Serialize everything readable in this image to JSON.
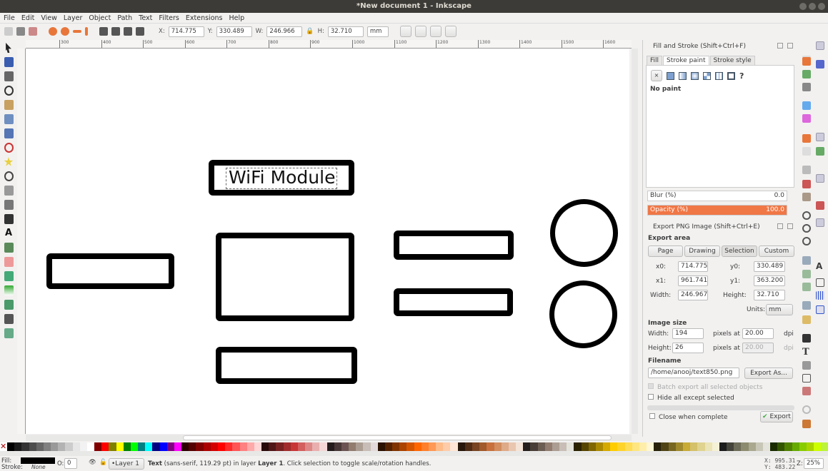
{
  "window": {
    "title": "*New document 1 - Inkscape"
  },
  "menu": [
    "File",
    "Edit",
    "View",
    "Layer",
    "Object",
    "Path",
    "Text",
    "Filters",
    "Extensions",
    "Help"
  ],
  "toolbar": {
    "x_label": "X:",
    "x": "714.775",
    "y_label": "Y:",
    "y": "330.489",
    "w_label": "W:",
    "w": "246.966",
    "h_label": "H:",
    "h": "32.710",
    "unit": "mm"
  },
  "ruler": [
    "300",
    "400",
    "500",
    "600",
    "700",
    "800",
    "900",
    "1000",
    "1100",
    "1200",
    "1300",
    "1400",
    "1500",
    "1600"
  ],
  "canvas": {
    "text": "WiFi Module"
  },
  "fill_stroke": {
    "title": "Fill and Stroke (Shift+Ctrl+F)",
    "tabs": [
      "Fill",
      "Stroke paint",
      "Stroke style"
    ],
    "paint": "No paint",
    "blur_label": "Blur (%)",
    "blur": "0.0",
    "opacity_label": "Opacity (%)",
    "opacity": "100.0",
    "opacity_color": "#f07746"
  },
  "export": {
    "title": "Export PNG Image (Shift+Ctrl+E)",
    "area_label": "Export area",
    "area_buttons": [
      "Page",
      "Drawing",
      "Selection",
      "Custom"
    ],
    "selected_area": "Selection",
    "x0_label": "x0:",
    "x0": "714.775",
    "y0_label": "y0:",
    "y0": "330.489",
    "x1_label": "x1:",
    "x1": "961.741",
    "y1_label": "y1:",
    "y1": "363.200",
    "width_label": "Width:",
    "width": "246.967",
    "height_label": "Height:",
    "height": "32.710",
    "units_label": "Units:",
    "units": "mm",
    "image_size_label": "Image size",
    "img_width_label": "Width:",
    "img_width": "194",
    "img_height_label": "Height:",
    "img_height": "26",
    "pixels_at": "pixels at",
    "dpi": "20.00",
    "dpi2": "20.00",
    "dpi_label": "dpi",
    "filename_label": "Filename",
    "filename": "/home/anooj/text850.png",
    "export_as": "Export As...",
    "batch": "Batch export all selected objects",
    "hide": "Hide all except selected",
    "close": "Close when complete",
    "export_button": "Export"
  },
  "status": {
    "fill_label": "Fill:",
    "stroke_label": "Stroke:",
    "stroke": "None",
    "opacity_label": "O:",
    "opacity": "0",
    "layer": "•Layer 1",
    "message_bold": "Text",
    "message": " (sans-serif, 119.29 pt) in layer ",
    "layer_bold": "Layer 1",
    "message_end": ". Click selection to toggle scale/rotation handles.",
    "cx": "X:  995.31",
    "cy": "Y:  483.22",
    "zoom_label": "Z:",
    "zoom": "25%"
  },
  "palette": [
    "#000",
    "#1a1a1a",
    "#333",
    "#4d4d4d",
    "#666",
    "#808080",
    "#999",
    "#b3b3b3",
    "#ccc",
    "#e6e6e6",
    "#f2f2f2",
    "#fff",
    "#800000",
    "#f00",
    "#808000",
    "#ff0",
    "#008000",
    "#0f0",
    "#008080",
    "#0ff",
    "#000080",
    "#00f",
    "#800080",
    "#f0f",
    "#2b0000",
    "#550000",
    "#800000",
    "#aa0000",
    "#d40000",
    "#f00",
    "#ff2a2a",
    "#f55",
    "#ff8080",
    "#faa",
    "#ffd5d5",
    "#280b0b",
    "#501616",
    "#782121",
    "#a02c2c",
    "#c83737",
    "#d35f5f",
    "#de8787",
    "#e9afaf",
    "#f4d7d7",
    "#241c1c",
    "#483737",
    "#6c5353",
    "#917c6f",
    "#ac9d93",
    "#c8beb7",
    "#e3dbdb",
    "#2b1100",
    "#552200",
    "#803300",
    "#aa4400",
    "#d45500",
    "#ff6600",
    "#ff7f2a",
    "#f95",
    "#fb8",
    "#fca",
    "#ffe6d5",
    "#28170b",
    "#502d16",
    "#784421",
    "#a05a2c",
    "#c8713e",
    "#d38d5f",
    "#deaa87",
    "#e9c6af",
    "#f4e3d7",
    "#241f1c",
    "#483e37",
    "#6c5d53",
    "#917c6f",
    "#ac9d93",
    "#c8beb7",
    "#e3e3db",
    "#2b2200",
    "#554400",
    "#806600",
    "#aa8800",
    "#d4aa00",
    "#fc0",
    "#ffd42a",
    "#fd5",
    "#ffe680",
    "#fea",
    "#fff6d5",
    "#28220b",
    "#504416",
    "#786721",
    "#a0892c",
    "#c8ab37",
    "#d4c16a",
    "#dfd38f",
    "#ebe4b7",
    "#f4f1d7",
    "#1c1c1c",
    "#44443a",
    "#6c6c58",
    "#8d8b6f",
    "#aaa88f",
    "#c8c7b7",
    "#e3e3db",
    "#1a2b00",
    "#335500",
    "#508000",
    "#6a0",
    "#88cc00",
    "#aad400",
    "#ccff00",
    "#bdf339"
  ]
}
